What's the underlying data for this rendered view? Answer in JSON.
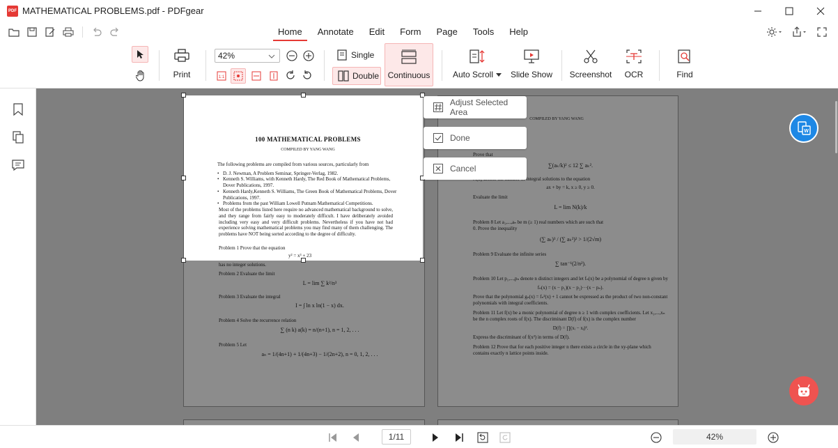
{
  "window": {
    "title": "MATHEMATICAL PROBLEMS.pdf - PDFgear",
    "logo_text": "PDF"
  },
  "menu": {
    "tabs": [
      "Home",
      "Annotate",
      "Edit",
      "Form",
      "Page",
      "Tools",
      "Help"
    ],
    "active": "Home"
  },
  "toolbar": {
    "print": "Print",
    "zoom_value": "42%",
    "single": "Single",
    "double": "Double",
    "continuous": "Continuous",
    "auto_scroll": "Auto Scroll",
    "slide_show": "Slide Show",
    "screenshot": "Screenshot",
    "ocr": "OCR",
    "find": "Find",
    "fit_actual": "1:1"
  },
  "context_menu": {
    "adjust": "Adjust Selected Area",
    "done": "Done",
    "cancel": "Cancel"
  },
  "document": {
    "left_page": {
      "title": "100 MATHEMATICAL PROBLEMS",
      "author": "COMPILED BY YANG WANG",
      "intro": "The following problems are compiled from various sources, particularly from",
      "bullets": [
        "D. J. Newman, A Problem Seminar, Springer-Verlag, 1982.",
        "Kenneth S. Williams, with Kenneth Hardy, The Red Book of Mathematical Problems, Dover Publications, 1997.",
        "Kenneth Hardy,Kenneth S. Williams, The Green Book of Mathematical Problems, Dover Publications, 1997.",
        "Problems from the past William Lowell Putnam Mathematical Competitions."
      ],
      "para": "Most of the problems listed here require no advanced mathematical background to solve, and they range from fairly easy to moderately difficult. I have deliberately avoided including very easy and very difficult problems. Nevertheless if you have not had experience solving mathematical problems you may find many of them challenging. The problems have NOT being sorted according to the degree of difficulty.",
      "p1": "Problem 1   Prove that the equation",
      "p1_eq": "y² = x³ + 23",
      "p1_end": "has no integer solutions.",
      "p2": "Problem 2   Evaluate the limit",
      "p3": "Problem 3   Evaluate the integral",
      "p4": "Problem 4   Solve the recurrence relation",
      "p5": "Problem 5   Let"
    },
    "right_page": {
      "author": "COMPILED BY YANG WANG",
      "lines": [
        "Prove that",
        "N(k) denote the number of integral solutions to the equation",
        "Evaluate the limit",
        "Problem 8   Let a₁,...,aₙ be m (≥ 1) real numbers which are such that",
        "0. Prove the inequality",
        "Problem 9   Evaluate the infinite series",
        "Problem 10   Let p₁,...,pₙ denote n distinct integers and let fₙ(x) be a polynomial of degree n given by",
        "Prove that the polynomial gₙ(x) = fₙ²(x) + 1 cannot be expressed as the product of two non-constant polynomials with integral coefficients.",
        "Problem 11   Let f(x) be a monic polynomial of degree n ≥ 1 with complex coefficients. Let x₁,...,xₙ be the n complex roots of f(x). The discriminant D(f) of f(x) is the complex number",
        "Express the discriminant of f(x²) in terms of D(f).",
        "Problem 12   Prove that for each positive integer n there exists a circle in the xy-plane which contains exactly n lattice points inside."
      ]
    }
  },
  "statusbar": {
    "page": "1/11",
    "zoom": "42%"
  },
  "colors": {
    "accent": "#e53935",
    "convert_fab": "#1e88e5",
    "assistant_fab": "#ef5350"
  }
}
